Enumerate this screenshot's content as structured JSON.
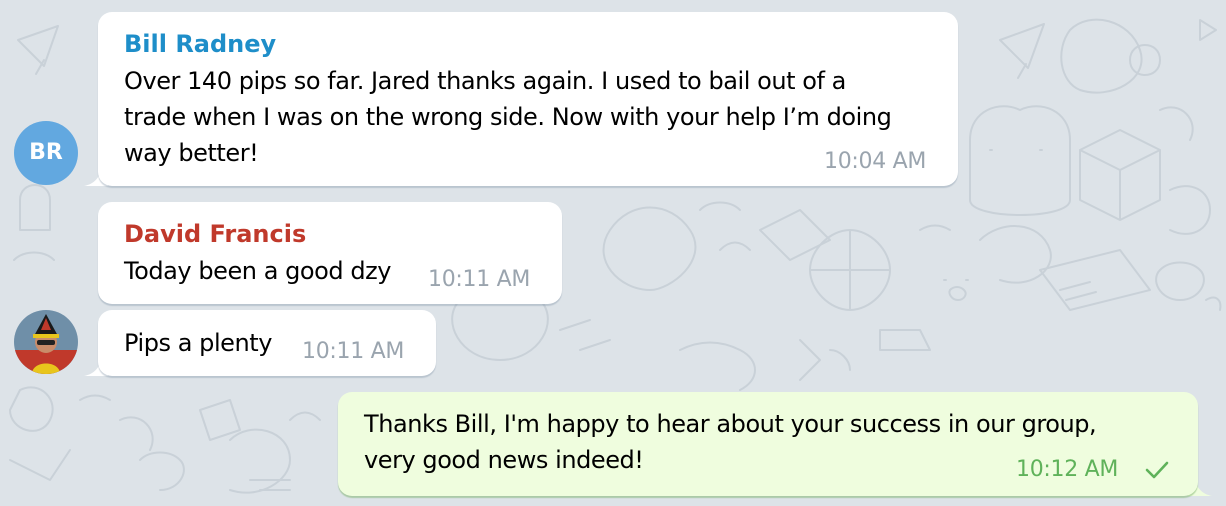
{
  "colors": {
    "background": "#dde3e8",
    "incoming_bubble": "#ffffff",
    "outgoing_bubble": "#effdde",
    "sender_bill": "#1e8ec9",
    "sender_david": "#c0392b",
    "time_incoming": "#9aa4ae",
    "time_outgoing": "#5fb25a",
    "avatar_bill": "#62a8e0"
  },
  "messages": [
    {
      "sender": "Bill Radney",
      "avatar_initials": "BR",
      "lines": [
        "Over 140 pips so far. Jared thanks again. I used to bail out of a",
        "trade when I was on the wrong side. Now with your help I’m doing",
        "way better!"
      ],
      "time": "10:04 AM"
    },
    {
      "sender": "David Francis",
      "text": "Today been a good dzy",
      "time": "10:11 AM"
    },
    {
      "text": "Pips a plenty",
      "time": "10:11 AM",
      "avatar_icon": "user-photo-avatar"
    },
    {
      "outgoing": true,
      "lines": [
        "Thanks Bill, I'm happy to hear about your success in our group,",
        "very good news indeed!"
      ],
      "time": "10:12 AM",
      "status_icon": "check-icon"
    }
  ]
}
